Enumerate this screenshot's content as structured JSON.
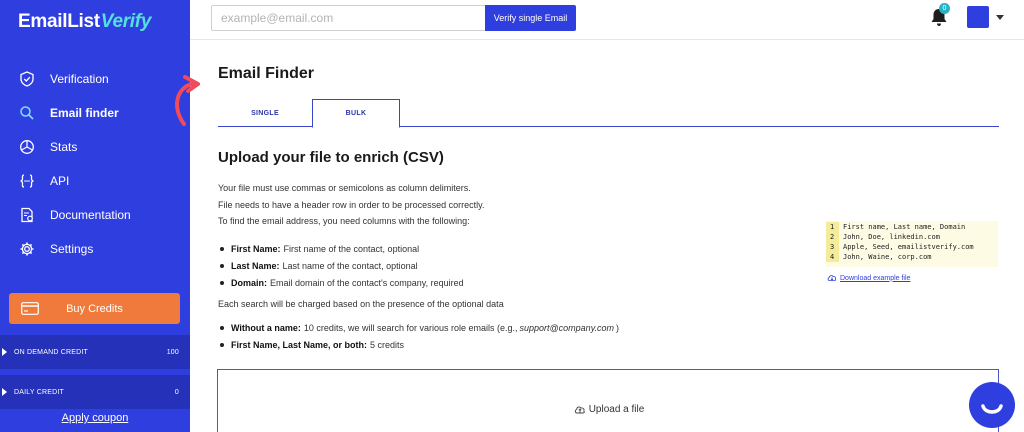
{
  "sidebar": {
    "logo": {
      "text_main": "EmailList",
      "text_accent": "Verify"
    },
    "items": [
      {
        "label": "Verification",
        "icon": "shield-check-icon"
      },
      {
        "label": "Email finder",
        "icon": "search-icon",
        "active": true
      },
      {
        "label": "Stats",
        "icon": "pie-chart-icon"
      },
      {
        "label": "API",
        "icon": "code-braces-icon"
      },
      {
        "label": "Documentation",
        "icon": "document-gear-icon"
      },
      {
        "label": "Settings",
        "icon": "gear-icon"
      }
    ],
    "buy_credits": "Buy Credits",
    "credits": [
      {
        "label": "ON DEMAND CREDIT",
        "value": "100"
      },
      {
        "label": "DAILY CREDIT",
        "value": "0"
      }
    ],
    "apply_coupon": "Apply coupon"
  },
  "topbar": {
    "email_placeholder": "example@email.com",
    "verify_button": "Verify single Email",
    "notification_count": "0"
  },
  "main": {
    "title": "Email Finder",
    "tabs": [
      {
        "label": "SINGLE",
        "active": false
      },
      {
        "label": "BULK",
        "active": true
      }
    ],
    "section_title": "Upload your file to enrich (CSV)",
    "intro": [
      "Your file must use commas or semicolons as column delimiters.",
      "File needs to have a header row in order to be processed correctly.",
      "To find the email address, you need columns with the following:"
    ],
    "columns": [
      {
        "name": "First Name:",
        "desc": "First name of the contact, optional"
      },
      {
        "name": "Last Name:",
        "desc": "Last name of the contact, optional"
      },
      {
        "name": "Domain:",
        "desc": "Email domain of the contact's company, required"
      }
    ],
    "charge_note": "Each search will be charged based on the presence of the optional data",
    "pricing": [
      {
        "name": "Without a name:",
        "desc_before": "10 credits, we will search for various role emails (e.g.,",
        "example": "support@company.com",
        "desc_after": ")"
      },
      {
        "name": "First Name, Last Name, or both:",
        "desc_before": "5 credits",
        "example": "",
        "desc_after": ""
      }
    ],
    "example_csv": [
      {
        "n": "1",
        "text": "First name, Last name, Domain"
      },
      {
        "n": "2",
        "text": "John, Doe, linkedin.com"
      },
      {
        "n": "3",
        "text": "Apple, Seed, emailistverify.com"
      },
      {
        "n": "4",
        "text": "John, Waine, corp.com"
      }
    ],
    "download_example": "Download example file",
    "upload_label": "Upload a file"
  },
  "colors": {
    "primary": "#2f3ede",
    "accent_orange": "#f07a3c",
    "logo_accent": "#55e0e0",
    "annotation_arrow": "#ef4b5a"
  }
}
